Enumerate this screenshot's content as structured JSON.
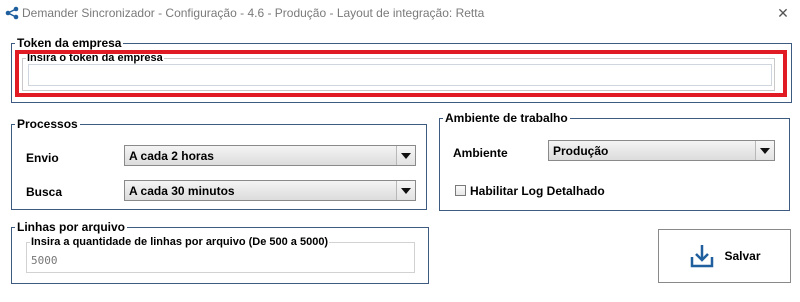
{
  "window": {
    "title": "Demander Sincronizador - Configuração - 4.6 - Produção - Layout de integração: Retta",
    "close_glyph": "✕"
  },
  "token": {
    "group_title": "Token da empresa",
    "field_title": "Insira o token da empresa",
    "value": ""
  },
  "processos": {
    "group_title": "Processos",
    "envio_label": "Envio",
    "envio_value": "A cada 2 horas",
    "busca_label": "Busca",
    "busca_value": "A cada 30 minutos"
  },
  "ambiente": {
    "group_title": "Ambiente de trabalho",
    "ambiente_label": "Ambiente",
    "ambiente_value": "Produção",
    "log_label": "Habilitar Log Detalhado",
    "log_checked": false
  },
  "linhas": {
    "group_title": "Linhas por arquivo",
    "field_title": "Insira a quantidade de linhas por arquivo (De 500 a 5000)",
    "value": "5000"
  },
  "actions": {
    "save_label": "Salvar",
    "save_icon": "download-tray-icon"
  },
  "colors": {
    "group_border": "#3d5a80",
    "highlight": "#e01b24",
    "icon_blue": "#1f5f9e",
    "title_text": "#7a7a7a"
  }
}
